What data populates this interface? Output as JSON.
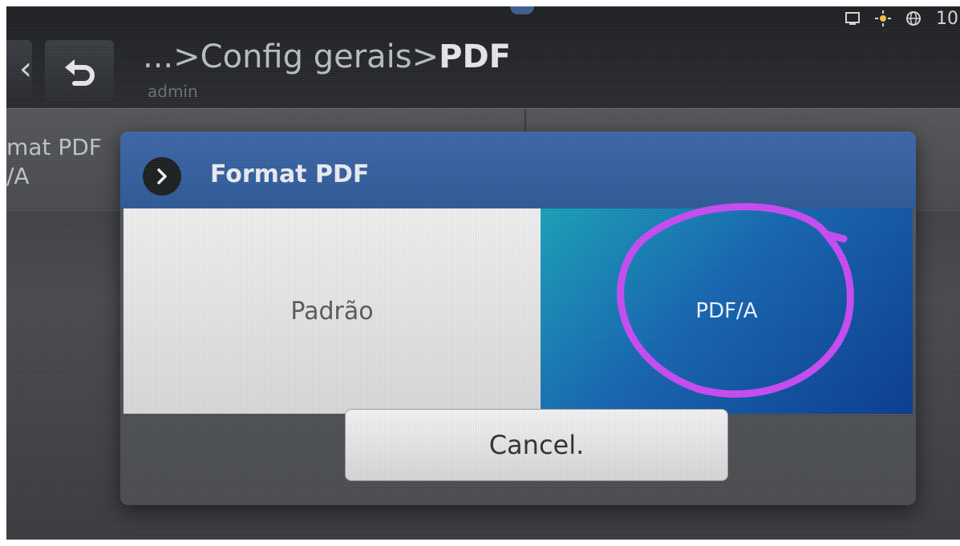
{
  "header": {
    "breadcrumb_prefix": "...>Config gerais>",
    "breadcrumb_current": "PDF",
    "user": "admin"
  },
  "status_bar": {
    "time_partial": "10",
    "icons": [
      "screen-icon",
      "brightness-icon",
      "globe-icon"
    ]
  },
  "background_row": {
    "label_line1": "mat PDF",
    "label_line2": "/A"
  },
  "dialog": {
    "title": "Format PDF",
    "options": [
      {
        "label": "Padrão",
        "selected": false
      },
      {
        "label": "PDF/A",
        "selected": true
      }
    ],
    "cancel_label": "Cancel."
  },
  "colors": {
    "header_blue": "#3e67a7",
    "selected_option": "#1765b0",
    "annotation": "#c64cf2"
  }
}
